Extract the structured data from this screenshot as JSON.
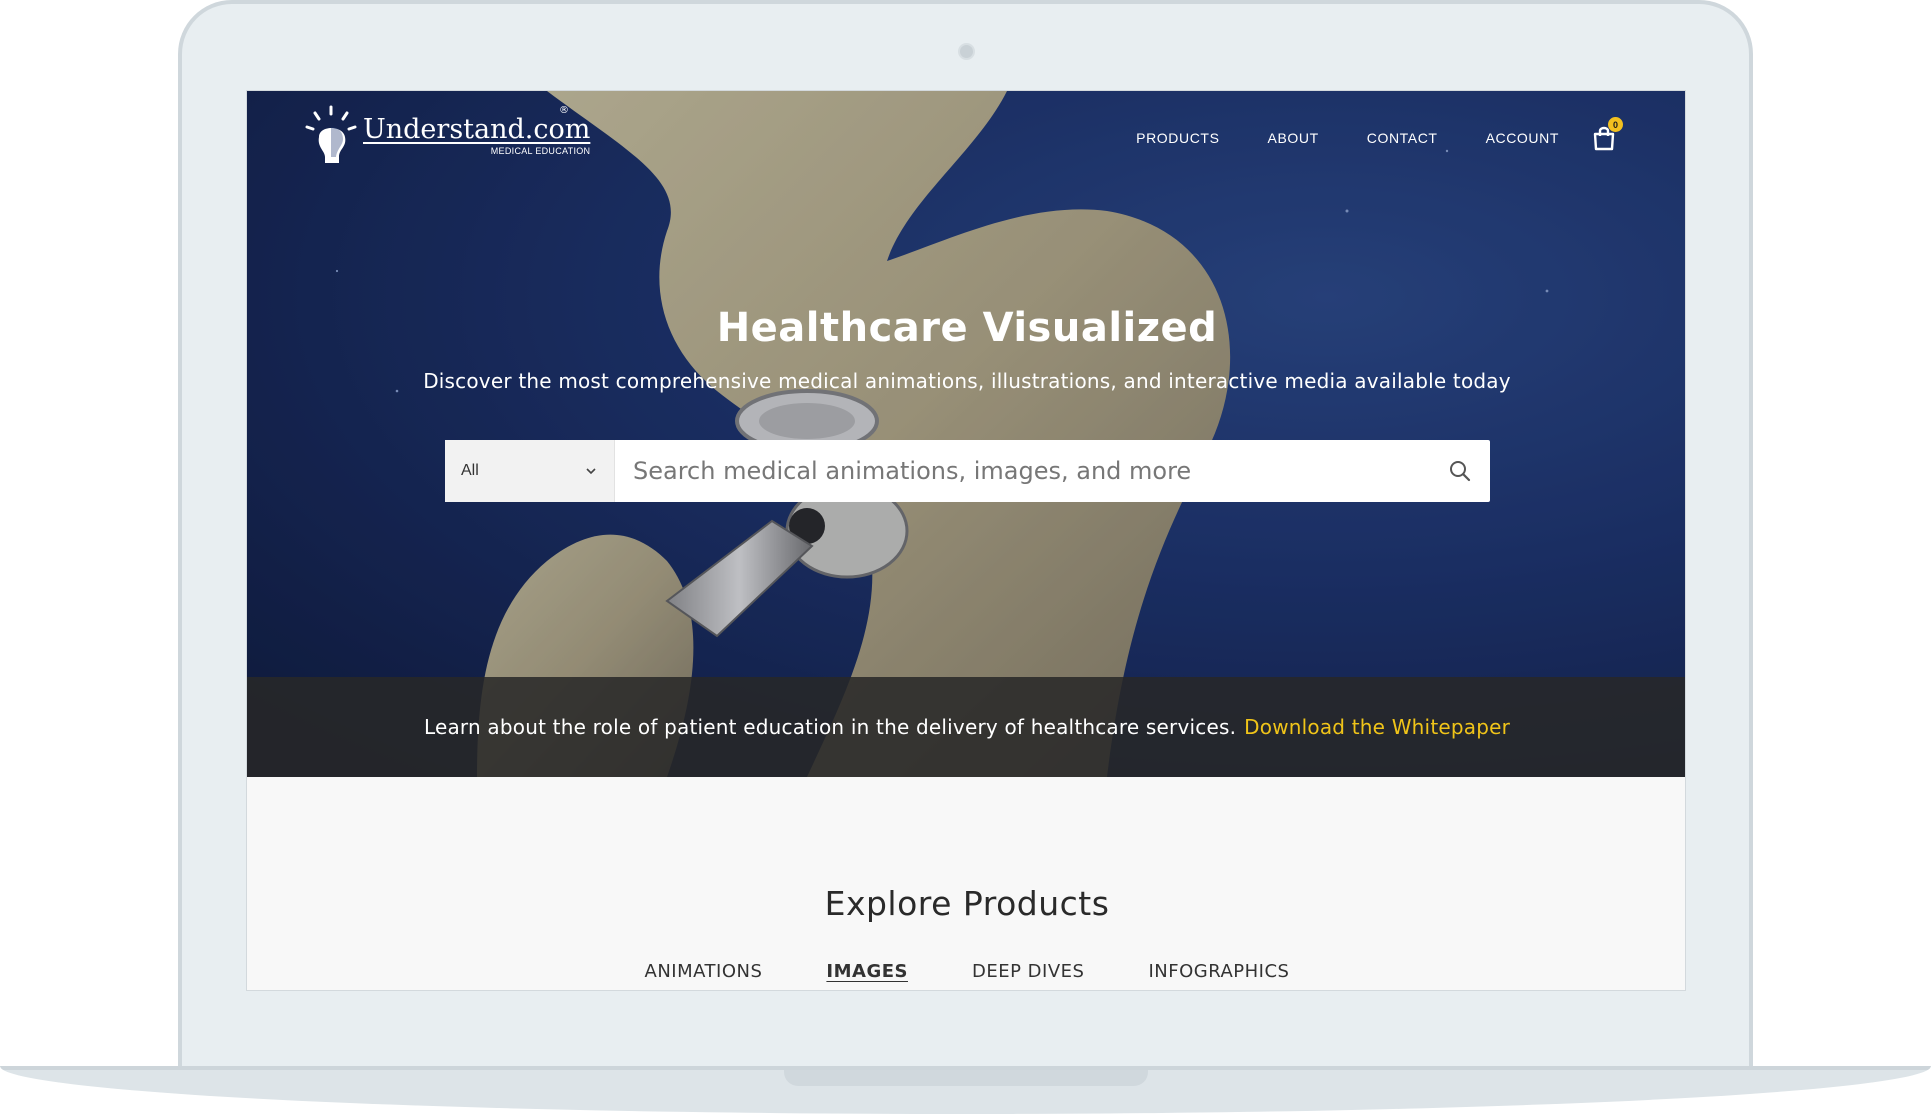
{
  "brand": {
    "name": "Understand.com",
    "tagline": "MEDICAL EDUCATION",
    "registered": "®"
  },
  "nav": {
    "items": [
      "PRODUCTS",
      "ABOUT",
      "CONTACT",
      "ACCOUNT"
    ],
    "cart_count": "0",
    "cart_icon": "shopping-bag-icon"
  },
  "hero": {
    "title": "Healthcare Visualized",
    "subtitle": "Discover the most comprehensive medical animations, illustrations, and interactive media available today"
  },
  "search": {
    "category_value": "All",
    "placeholder": "Search medical animations, images, and more",
    "value": "",
    "icon": "search-icon"
  },
  "banner": {
    "text": "Learn about the role of patient education in the delivery of healthcare services.",
    "link": "Download the Whitepaper",
    "link_color": "#f0c419"
  },
  "explore": {
    "title": "Explore Products",
    "tabs": [
      "ANIMATIONS",
      "IMAGES",
      "DEEP DIVES",
      "INFOGRAPHICS"
    ],
    "active_tab": "IMAGES"
  },
  "colors": {
    "accent": "#f0c419",
    "hero_bg": "#1e3570",
    "banner_bg": "#282828"
  }
}
